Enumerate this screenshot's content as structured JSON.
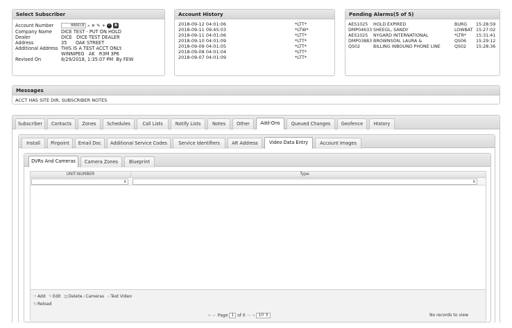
{
  "subscriber": {
    "title": "Select Subscriber",
    "account_label": "Account Number",
    "account_value": "00DICE",
    "badge": "B",
    "company_label": "Company Name",
    "company_value": "DICE TEST - PUT ON HOLD",
    "dealer_label": "Dealer",
    "dealer_value": "DICE   DICE TEST DEALER",
    "address_label": "Address",
    "address_value": "35      OAK STREET",
    "addl_label": "Additional Address",
    "addl_value": "THIS IS A TEST ACCT ONLY.",
    "city_value": "WINNIPEG   AK   R3M 3P6",
    "revised_label": "Revised On",
    "revised_value": "8/29/2018, 1:35:07 PM  By FEW"
  },
  "history": {
    "title": "Account History",
    "rows": [
      {
        "ts": "2018-09-12 04:01:06",
        "code": "*LTT*"
      },
      {
        "ts": "2018-09-11 09:45:03",
        "code": "*LTW*"
      },
      {
        "ts": "2018-09-11 04:01:06",
        "code": "*LTT*"
      },
      {
        "ts": "2018-09-10 04:01:09",
        "code": "*LTT*"
      },
      {
        "ts": "2018-09-09 04:01:05",
        "code": "*LTT*"
      },
      {
        "ts": "2018-09-08 04:01:04",
        "code": "*LTT*"
      },
      {
        "ts": "2018-09-07 04:01:09",
        "code": "*LTT*"
      }
    ]
  },
  "alarms": {
    "title": "Pending Alarms(5 of 5)",
    "rows": [
      {
        "acct": "AES1025",
        "name": "HOLD EXPIRED",
        "code": "BURG",
        "time": "15:28:59"
      },
      {
        "acct": "DMP04633",
        "name": "SHEEGL, SANDY",
        "code": "LOWBAT",
        "time": "15:27:02"
      },
      {
        "acct": "AES1025",
        "name": "NYGARD INTERNATIONAL",
        "code": "*LTR*",
        "time": "15:31:41"
      },
      {
        "acct": "DMP03883",
        "name": "BROWNSON, LAURA &",
        "code": "QS06",
        "time": "15:29:12"
      },
      {
        "acct": "QS02",
        "name": "BILLING INBOUND PHONE LINE",
        "code": "QS02",
        "time": "15:28:36"
      }
    ]
  },
  "messages": {
    "title": "Messages",
    "text": "ACCT HAS SITE DIR, SUBSCRIBER NOTES"
  },
  "tabs": [
    "Subscriber",
    "Contacts",
    "Zones",
    "Schedules",
    "Call Lists",
    "Notify Lists",
    "Notes",
    "Other",
    "Add-Ons",
    "Queued Changes",
    "Geofence",
    "History"
  ],
  "subtabs": [
    "Install",
    "Pinpoint",
    "Email Doc",
    "Additional Service Codes",
    "Service Identifiers",
    "AR Address",
    "Video Data Entry",
    "Account Images"
  ],
  "subtabs2": [
    "DVRs And Cameras",
    "Camera Zones",
    "Blueprint"
  ],
  "grid": {
    "col_unit": "UNIT-NUMBER",
    "col_type": "Type",
    "clear": "x",
    "actions": [
      "Add",
      "Edit",
      "Delete",
      "Cameras",
      "Test Video"
    ],
    "reload": "Reload",
    "page_label": "Page",
    "page_value": "1",
    "of_label": "of 0",
    "page_size": "10",
    "no_records": "No records to view"
  }
}
